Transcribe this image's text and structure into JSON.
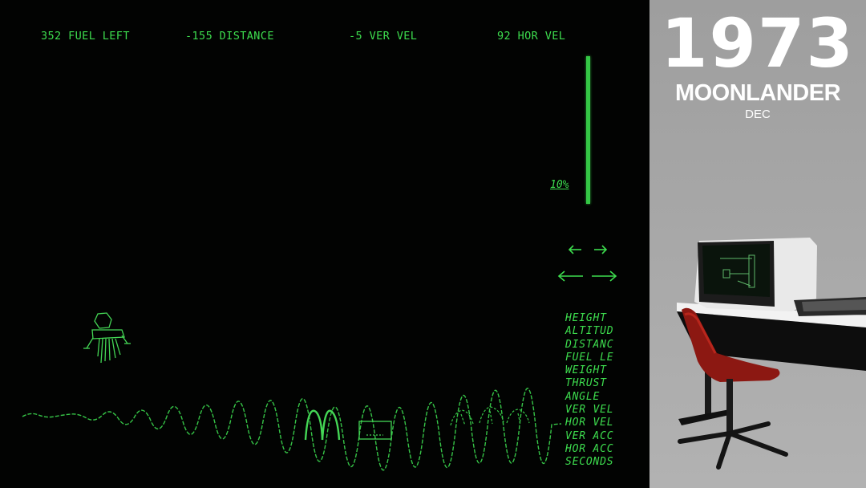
{
  "hud": {
    "fuel": "352 FUEL LEFT",
    "distance": "-155 DISTANCE",
    "ver_vel": "-5 VER VEL",
    "hor_vel": "92 HOR VEL"
  },
  "thrust": {
    "label": "10%",
    "level": 0.1
  },
  "controls": {
    "small_left": "small-left-arrow-icon",
    "small_right": "small-right-arrow-icon",
    "large_left": "large-left-arrow-icon",
    "large_right": "large-right-arrow-icon"
  },
  "menu": {
    "items": [
      "HEIGHT",
      "ALTITUD",
      "DISTANC",
      "FUEL LE",
      "WEIGHT",
      "THRUST",
      "ANGLE",
      "VER VEL",
      "HOR VEL",
      "VER ACC",
      "HOR ACC",
      "SECONDS"
    ]
  },
  "panel": {
    "year": "1973",
    "title": "MOONLANDER",
    "publisher": "DEC"
  },
  "colors": {
    "phosphor": "#3ddc4e",
    "screen": "#020302",
    "panel": "#a6a6a6"
  }
}
